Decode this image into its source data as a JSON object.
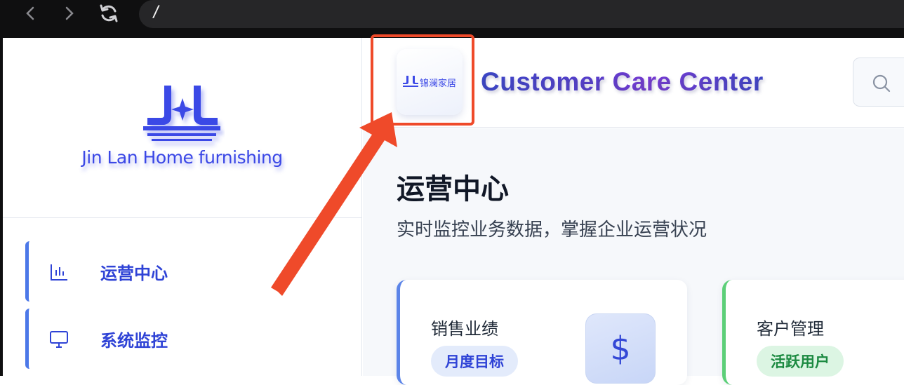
{
  "browser": {
    "url": "/"
  },
  "sidebar": {
    "brand_text": "Jin Lan Home furnishing",
    "items": [
      {
        "label": "运营中心",
        "icon": "bar-chart-icon"
      },
      {
        "label": "系统监控",
        "icon": "monitor-icon"
      }
    ]
  },
  "header": {
    "logo_text": "锦澜家居",
    "title": "Customer Care Center"
  },
  "main": {
    "title": "运营中心",
    "subtitle": "实时监控业务数据，掌握企业运营状况",
    "cards": [
      {
        "title": "销售业绩",
        "tag": "月度目标",
        "icon": "$"
      },
      {
        "title": "客户管理",
        "tag": "活跃用户"
      }
    ]
  },
  "colors": {
    "accent": "#3b48e6",
    "annotation": "#ef4a2a",
    "sales_border": "#5b84e8",
    "customer_border": "#5ccf78"
  }
}
